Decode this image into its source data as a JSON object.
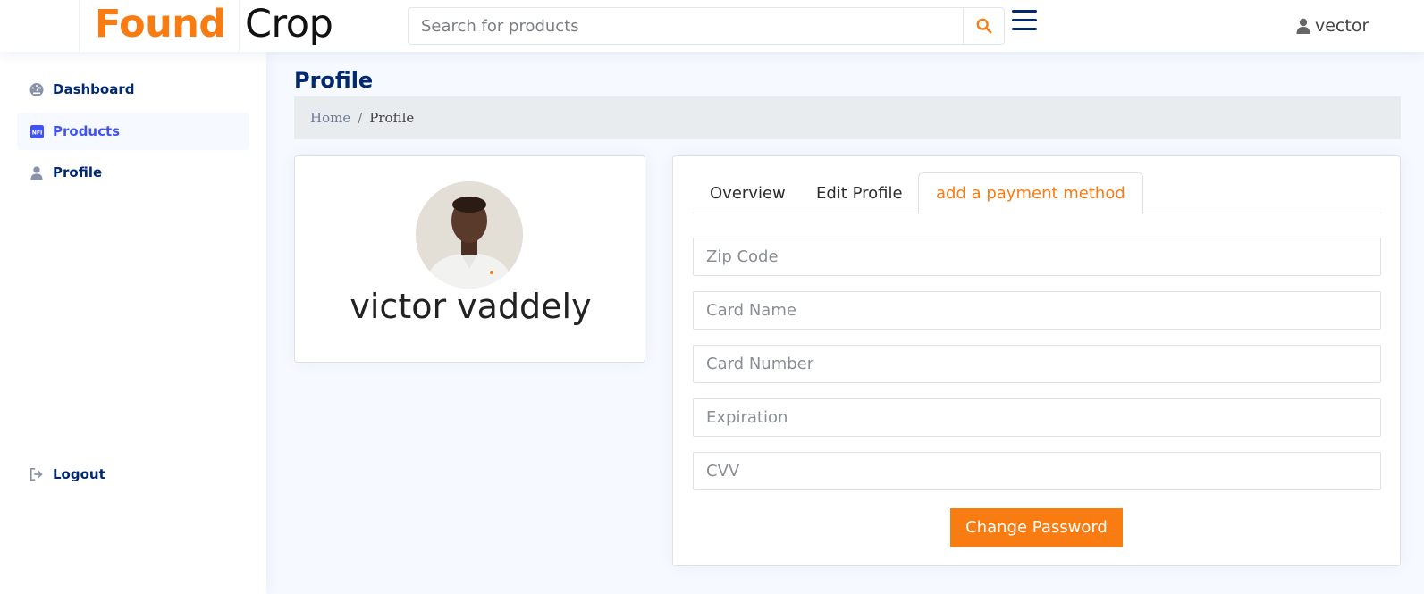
{
  "brand": {
    "found": "Found",
    "crop": "Crop"
  },
  "search": {
    "placeholder": "Search for products"
  },
  "user": {
    "name": "vector"
  },
  "sidebar": {
    "items": [
      {
        "label": "Dashboard",
        "icon": "dashboard-icon"
      },
      {
        "label": "Products",
        "icon": "nft-icon"
      },
      {
        "label": "Profile",
        "icon": "person-icon"
      }
    ],
    "logout": "Logout"
  },
  "page": {
    "title": "Profile",
    "breadcrumb": {
      "home": "Home",
      "separator": "/",
      "current": "Profile"
    }
  },
  "profile": {
    "name": "victor vaddely"
  },
  "tabs": [
    {
      "label": "Overview"
    },
    {
      "label": "Edit Profile"
    },
    {
      "label": "add a payment method"
    }
  ],
  "payment_form": {
    "zip": "Zip Code",
    "card_name": "Card Name",
    "card_number": "Card Number",
    "expiration": "Expiration",
    "cvv": "CVV",
    "submit": "Change Password"
  },
  "colors": {
    "accent": "#f97c12",
    "navy": "#012970",
    "active_link": "#4154f1"
  }
}
